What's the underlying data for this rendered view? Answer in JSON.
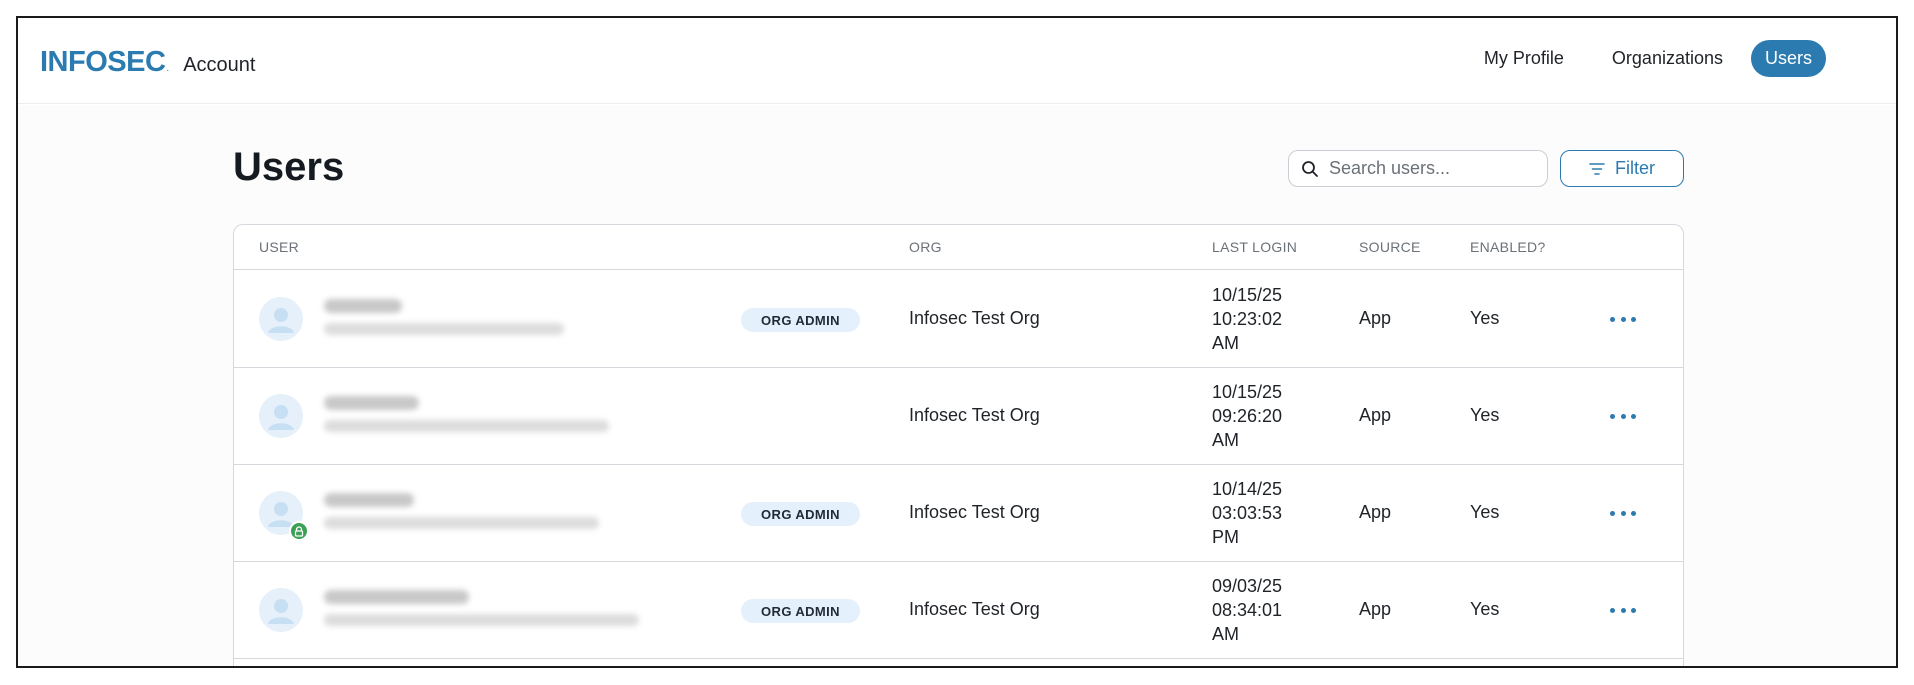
{
  "header": {
    "logo": "INFOSEC",
    "app_name": "Account",
    "nav": [
      {
        "label": "My Profile",
        "active": false
      },
      {
        "label": "Organizations",
        "active": false
      },
      {
        "label": "Users",
        "active": true
      }
    ]
  },
  "page": {
    "title": "Users",
    "search_placeholder": "Search users...",
    "filter_label": "Filter"
  },
  "table": {
    "columns": [
      "USER",
      "ORG",
      "LAST LOGIN",
      "SOURCE",
      "ENABLED?"
    ],
    "rows": [
      {
        "role": "ORG ADMIN",
        "org": "Infosec Test Org",
        "login_date": "10/15/25",
        "login_time": "10:23:02",
        "login_ampm": "AM",
        "source": "App",
        "enabled": "Yes",
        "locked": false
      },
      {
        "role": "",
        "org": "Infosec Test Org",
        "login_date": "10/15/25",
        "login_time": "09:26:20",
        "login_ampm": "AM",
        "source": "App",
        "enabled": "Yes",
        "locked": false
      },
      {
        "role": "ORG ADMIN",
        "org": "Infosec Test Org",
        "login_date": "10/14/25",
        "login_time": "03:03:53",
        "login_ampm": "PM",
        "source": "App",
        "enabled": "Yes",
        "locked": true
      },
      {
        "role": "ORG ADMIN",
        "org": "Infosec Test Org",
        "login_date": "09/03/25",
        "login_time": "08:34:01",
        "login_ampm": "AM",
        "source": "App",
        "enabled": "Yes",
        "locked": false
      }
    ]
  },
  "colors": {
    "brand": "#2b7bb0",
    "badge_bg": "#e4f0fb",
    "lock_green": "#3aa055"
  }
}
